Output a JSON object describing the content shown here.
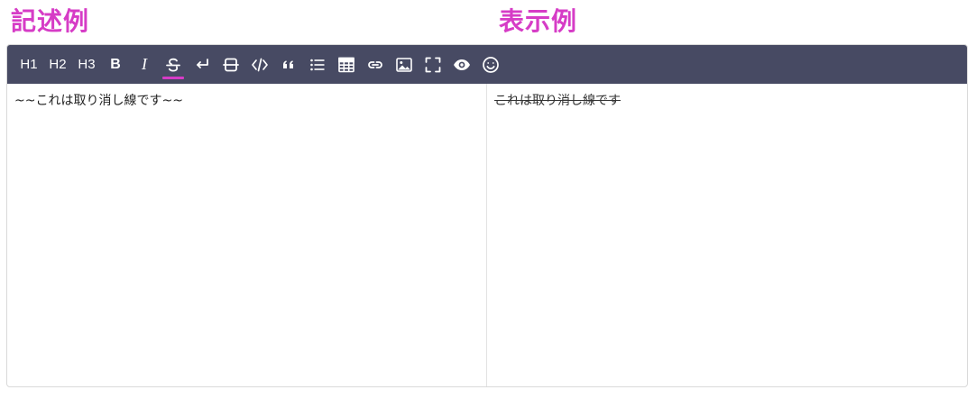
{
  "headings": {
    "source": "記述例",
    "preview": "表示例"
  },
  "colors": {
    "accent": "#d63cc6",
    "toolbar_bg": "#474a63",
    "toolbar_fg": "#ffffff"
  },
  "toolbar": {
    "h1": "H1",
    "h2": "H2",
    "h3": "H3",
    "bold": "B",
    "italic": "I",
    "icons": [
      "strikethrough-icon",
      "line-break-icon",
      "horizontal-rule-icon",
      "code-icon",
      "quote-icon",
      "list-icon",
      "table-icon",
      "link-icon",
      "image-icon",
      "fullscreen-icon",
      "preview-eye-icon",
      "emoji-icon"
    ],
    "active": "strikethrough-icon"
  },
  "editor": {
    "source_text": "~~これは取り消し線です~~",
    "preview_text": "これは取り消し線です"
  }
}
